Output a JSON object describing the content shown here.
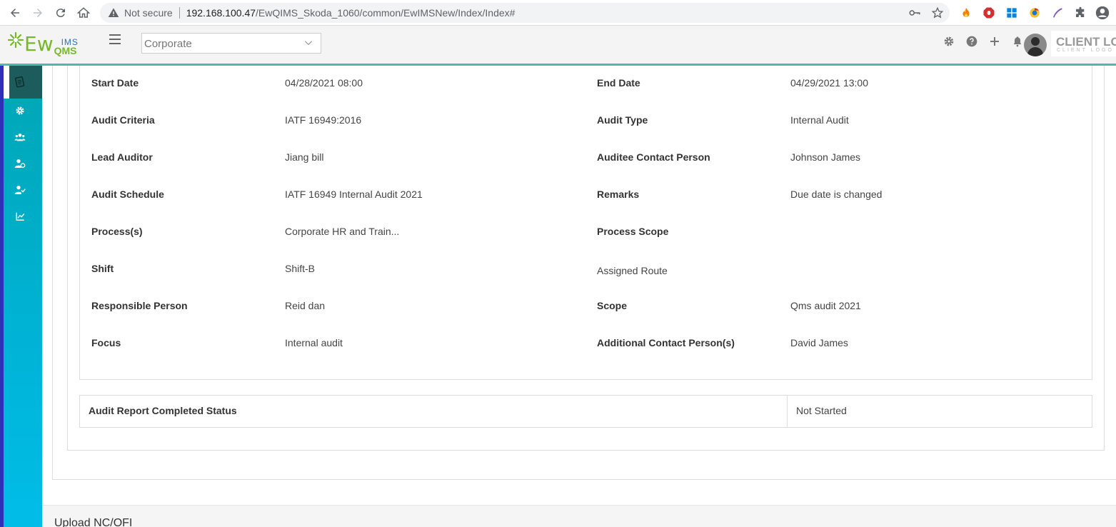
{
  "browser": {
    "security_label": "Not secure",
    "url_host": "192.168.100.47",
    "url_path": "/EwQIMS_Skoda_1060/common/EwIMSNew/Index/Index#"
  },
  "header": {
    "logo_main": "Ew",
    "logo_sup": "IMS",
    "logo_sub": "QMS",
    "corporate_select": "Corporate",
    "client_logo_line1": "CLIENT LOGO",
    "client_logo_line2": "CLIENT LOGO"
  },
  "details": {
    "left": [
      {
        "label": "Start Date",
        "value": "04/28/2021 08:00"
      },
      {
        "label": "Audit Criteria",
        "value": "IATF 16949:2016"
      },
      {
        "label": "Lead Auditor",
        "value": "Jiang bill"
      },
      {
        "label": "Audit Schedule",
        "value": "IATF 16949 Internal Audit 2021"
      },
      {
        "label": "Process(s)",
        "value": "Corporate HR and Train..."
      },
      {
        "label": "Shift",
        "value": "Shift-B"
      },
      {
        "label": "Responsible Person",
        "value": "Reid dan"
      },
      {
        "label": "Focus",
        "value": "Internal audit"
      }
    ],
    "right": [
      {
        "label": "End Date",
        "value": "04/29/2021 13:00"
      },
      {
        "label": "Audit Type",
        "value": "Internal Audit"
      },
      {
        "label": "Auditee Contact Person",
        "value": "Johnson James"
      },
      {
        "label": "Remarks",
        "value": "Due date is changed"
      },
      {
        "label": "Process Scope",
        "value": ""
      },
      {
        "label": "Assigned Route",
        "value": ""
      },
      {
        "label": "Scope",
        "value": "Qms audit 2021"
      },
      {
        "label": "Additional Contact Person(s)",
        "value": "David James"
      }
    ]
  },
  "status": {
    "label": "Audit Report Completed Status",
    "value": "Not Started"
  },
  "upload": {
    "title": "Upload NC/OFI"
  },
  "colors": {
    "accent": "#4fb8ab",
    "sidebar": "#00b3d6",
    "sidebar_active": "#1d5c5c",
    "logo_green": "#76b82a"
  }
}
